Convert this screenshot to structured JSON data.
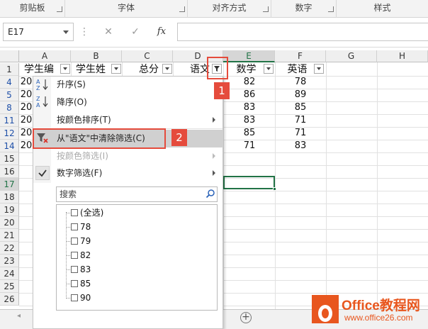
{
  "ribbon": {
    "groups": [
      "剪贴板",
      "字体",
      "对齐方式",
      "数字",
      "样式"
    ]
  },
  "formula_bar": {
    "name_box": "E17",
    "cancel": "✕",
    "enter": "✓",
    "fx": "fx",
    "separator": "⋮",
    "value": ""
  },
  "columns": [
    "A",
    "B",
    "C",
    "D",
    "E",
    "F",
    "G",
    "H"
  ],
  "rows": [
    "1",
    "4",
    "5",
    "8",
    "11",
    "12",
    "14",
    "15",
    "16",
    "17",
    "18",
    "19",
    "20",
    "21",
    "22",
    "23",
    "24",
    "25",
    "26"
  ],
  "headers": {
    "a": "学生编",
    "b": "学生姓",
    "c": "总分",
    "d": "语文",
    "e": "数学",
    "f": "英语"
  },
  "row_a_values": [
    "20",
    "20",
    "20",
    "20",
    "20",
    "20"
  ],
  "math_values": [
    "82",
    "86",
    "83",
    "83",
    "85",
    "71"
  ],
  "english_values": [
    "78",
    "89",
    "85",
    "71",
    "71",
    "83"
  ],
  "menu": {
    "items": [
      {
        "label": "升序(S)"
      },
      {
        "label": "降序(O)"
      },
      {
        "label": "按颜色排序(T)"
      },
      {
        "label": "从\"语文\"中清除筛选(C)"
      },
      {
        "label": "按颜色筛选(I)"
      },
      {
        "label": "数字筛选(F)"
      }
    ],
    "search_placeholder": "搜索",
    "list": [
      "(全选)",
      "78",
      "79",
      "82",
      "83",
      "85",
      "90"
    ]
  },
  "callouts": [
    "1",
    "2"
  ],
  "sheet_tabs": {
    "add": "+",
    "nav_left": "◂"
  },
  "watermark": {
    "line1": "Office教程网",
    "line2": "www.office26.com"
  },
  "colors": {
    "accent_red": "#e54b3c",
    "excel_green": "#217346",
    "logo_orange": "#e8561e",
    "row_number_blue": "#1e4fa8"
  }
}
